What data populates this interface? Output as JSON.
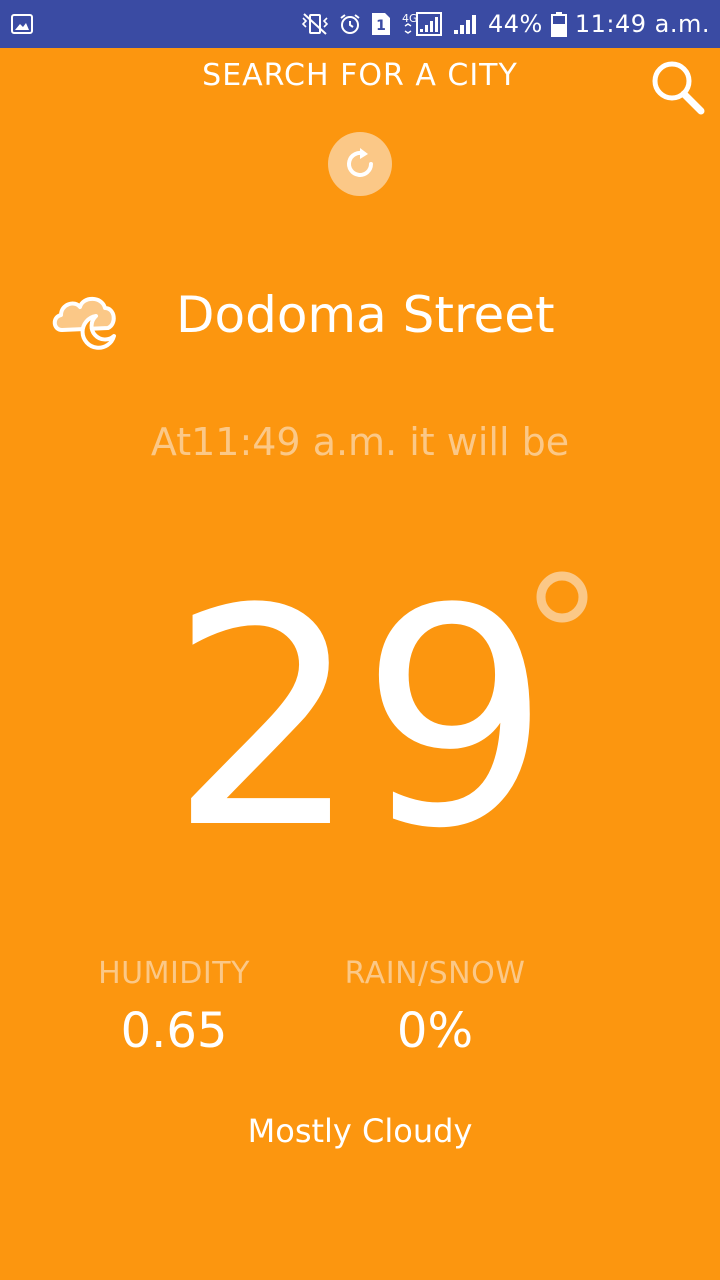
{
  "status_bar": {
    "battery": "44%",
    "time": "11:49 a.m.",
    "network": "4G",
    "sim": "1",
    "icons": [
      "gallery-icon",
      "mute-vibrate-icon",
      "alarm-icon",
      "sim-icon",
      "4g-icon",
      "signal-icon",
      "signal-icon",
      "battery-icon"
    ]
  },
  "header": {
    "title": "SEARCH FOR A CITY",
    "search_icon": "search-icon",
    "refresh_icon": "refresh-icon"
  },
  "location": {
    "name": "Dodoma Street",
    "weather_icon": "cloud-moon-icon"
  },
  "forecast": {
    "time_text": "At11:49 a.m. it will be",
    "temperature": "29",
    "degree_icon": "degree-icon"
  },
  "stats": {
    "humidity_label": "HUMIDITY",
    "humidity_value": "0.65",
    "rain_label": "RAIN/SNOW",
    "rain_value": "0%"
  },
  "summary": "Mostly Cloudy",
  "colors": {
    "background": "#FC960F",
    "status_bar": "#3A4BA3",
    "accent_light": "#FBC887",
    "text": "#FFFFFF"
  }
}
